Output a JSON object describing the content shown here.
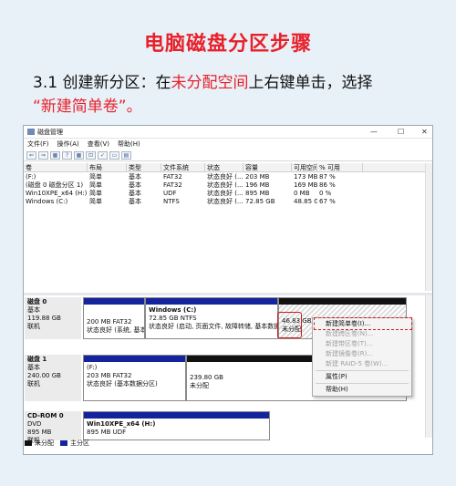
{
  "heading": "电脑磁盘分区步骤",
  "step": {
    "num": "3.1",
    "pre": "创建新分区：在",
    "highlight": "未分配空间",
    "post": "上右键单击，选择",
    "quote": "“新建简单卷”。"
  },
  "window": {
    "title": "磁盘管理",
    "menus": [
      "文件(F)",
      "操作(A)",
      "查看(V)",
      "帮助(H)"
    ],
    "toolbar": [
      "⇐",
      "⇒",
      "▦",
      "?",
      "▦",
      "⊡",
      "✓",
      "▭",
      "▤"
    ],
    "columns": [
      "卷",
      "布局",
      "类型",
      "文件系统",
      "状态",
      "容量",
      "可用空间",
      "% 可用"
    ],
    "rows": [
      [
        "(F:)",
        "简单",
        "基本",
        "FAT32",
        "状态良好 (...",
        "203 MB",
        "173 MB",
        "87 %"
      ],
      [
        "(磁盘 0 磁盘分区 1)",
        "简单",
        "基本",
        "FAT32",
        "状态良好 (...",
        "196 MB",
        "169 MB",
        "86 %"
      ],
      [
        "Win10XPE_x64 (H:)",
        "简单",
        "基本",
        "UDF",
        "状态良好 (...",
        "895 MB",
        "0 MB",
        "0 %"
      ],
      [
        "Windows (C:)",
        "简单",
        "基本",
        "NTFS",
        "状态良好 (...",
        "72.85 GB",
        "48.85 GB",
        "67 %"
      ]
    ]
  },
  "disks": {
    "d0": {
      "name": "磁盘 0",
      "type": "基本",
      "size": "119.88 GB",
      "status": "联机",
      "p1": {
        "size": "200 MB FAT32",
        "status": "状态良好 (系统, 基本"
      },
      "p2": {
        "name": "Windows  (C:)",
        "size": "72.85 GB NTFS",
        "status": "状态良好 (启动, 页面文件, 故障转储, 基本数据"
      },
      "p3": {
        "size": "46.83 GB",
        "status": "未分配"
      }
    },
    "d1": {
      "name": "磁盘 1",
      "type": "基本",
      "size": "240.00 GB",
      "status": "联机",
      "p1": {
        "name": "(F:)",
        "size": "203 MB FAT32",
        "status": "状态良好 (基本数据分区)"
      },
      "p2": {
        "size": "239.80 GB",
        "status": "未分配"
      }
    },
    "cd": {
      "name": "CD-ROM 0",
      "type": "DVD",
      "size": "895 MB",
      "status": "联机",
      "p1": {
        "name": "Win10XPE_x64  (H:)",
        "size": "895 MB UDF"
      }
    }
  },
  "context_menu": {
    "items": [
      "新建简单卷(I)...",
      "新建跨区卷(N)...",
      "新建带区卷(T)...",
      "新建镜像卷(R)...",
      "新建 RAID-5 卷(W)...",
      "属性(P)",
      "帮助(H)"
    ]
  },
  "legend": [
    "未分配",
    "主分区"
  ],
  "colors": {
    "accent": "#e8202a",
    "primary_partition": "#13249c",
    "unallocated": "#111111"
  }
}
